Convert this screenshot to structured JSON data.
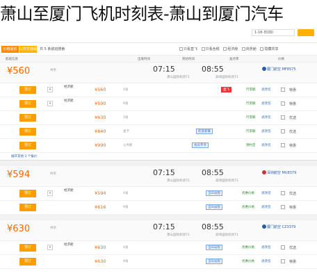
{
  "page_title": "萧山至厦门飞机时刻表-萧山到厦门汽车",
  "topbar": {
    "date": "1-18-日(四)",
    "city": "出发城市"
  },
  "filters": {
    "tab1": "价格最低",
    "tab2": "公共交通最优",
    "text": "共 5 条航班搜索",
    "options": [
      "只看直飞",
      "只看含税",
      "经济舱",
      "商务舱",
      "隐藏共享"
    ]
  },
  "sort": [
    "航班信息",
    "出发时间",
    "到达时间",
    "准点率",
    "价格"
  ],
  "flights": [
    {
      "price": "¥560",
      "price_note": "起",
      "dep": "07:15",
      "arr": "08:55",
      "dep_airport": "萧山国际机场T3",
      "arr_airport": "高崎国际机场T3",
      "airline": "厦门航空 MF8575",
      "extra": "共享",
      "rows": [
        {
          "book": "预订",
          "cabin": "经济舱",
          "price": "¥560",
          "note": "4张",
          "tag": "直飞",
          "tag_red": true,
          "c1": "行李额",
          "c2": "退改签",
          "right": "特惠"
        },
        {
          "book": "预订",
          "cabin": "经济舱",
          "price": "¥590",
          "note": "9张",
          "tag": "",
          "tag_red": false,
          "c1": "行李额",
          "c2": "退改签",
          "right": "特惠"
        },
        {
          "book": "预订",
          "cabin": "",
          "price": "¥630",
          "note": "3张",
          "tag": "",
          "tag_red": false,
          "c1": "行李额",
          "c2": "退改签",
          "right": "优选"
        },
        {
          "book": "预订",
          "cabin": "",
          "price": "¥840",
          "note": "金卡",
          "tag": "航旅套餐",
          "tag_red": false,
          "c1": "行李额",
          "c2": "退改签",
          "right": "优选"
        },
        {
          "book": "预订",
          "cabin": "",
          "price": "¥990",
          "note": "公务舱",
          "tag": "会员专享",
          "tag_red": false,
          "c1": "预约定",
          "c2": "退改签",
          "right": "特惠"
        }
      ],
      "expand": "展开其他 3 个报价"
    },
    {
      "price": "¥594",
      "price_note": "起",
      "dep": "07:15",
      "arr": "08:55",
      "dep_airport": "萧山国际机场T3",
      "arr_airport": "高崎国际机场T3",
      "airline": "深圳航空 MU8379",
      "extra": "共享",
      "rows": [
        {
          "book": "预订",
          "cabin": "经济舱",
          "price": "¥594",
          "note": "4张",
          "tag": "当日返程",
          "tag_red": false,
          "c1": "优惠价格",
          "c2": "退改签",
          "right": "优选"
        },
        {
          "book": "预订",
          "cabin": "",
          "price": "¥616",
          "note": "9张",
          "tag": "当日返程",
          "tag_red": false,
          "c1": "优惠价格",
          "c2": "退改签",
          "right": "特惠"
        }
      ],
      "expand": ""
    },
    {
      "price": "¥630",
      "price_note": "起",
      "dep": "07:15",
      "arr": "08:55",
      "dep_airport": "萧山国际机场T3",
      "arr_airport": "高崎国际机场T3",
      "airline": "厦门航空 CZ3379",
      "extra": "共享",
      "rows": [
        {
          "book": "预订",
          "cabin": "经济舱",
          "price": "¥630",
          "note": "4张",
          "tag": "当日返程",
          "tag_red": false,
          "c1": "优惠价格",
          "c2": "退改签",
          "right": "优选"
        },
        {
          "book": "预订",
          "cabin": "",
          "price": "¥630",
          "note": "9张",
          "tag": "当日返程",
          "tag_red": false,
          "c1": "优惠价格",
          "c2": "退改签",
          "right": "特惠"
        }
      ],
      "expand": ""
    }
  ]
}
